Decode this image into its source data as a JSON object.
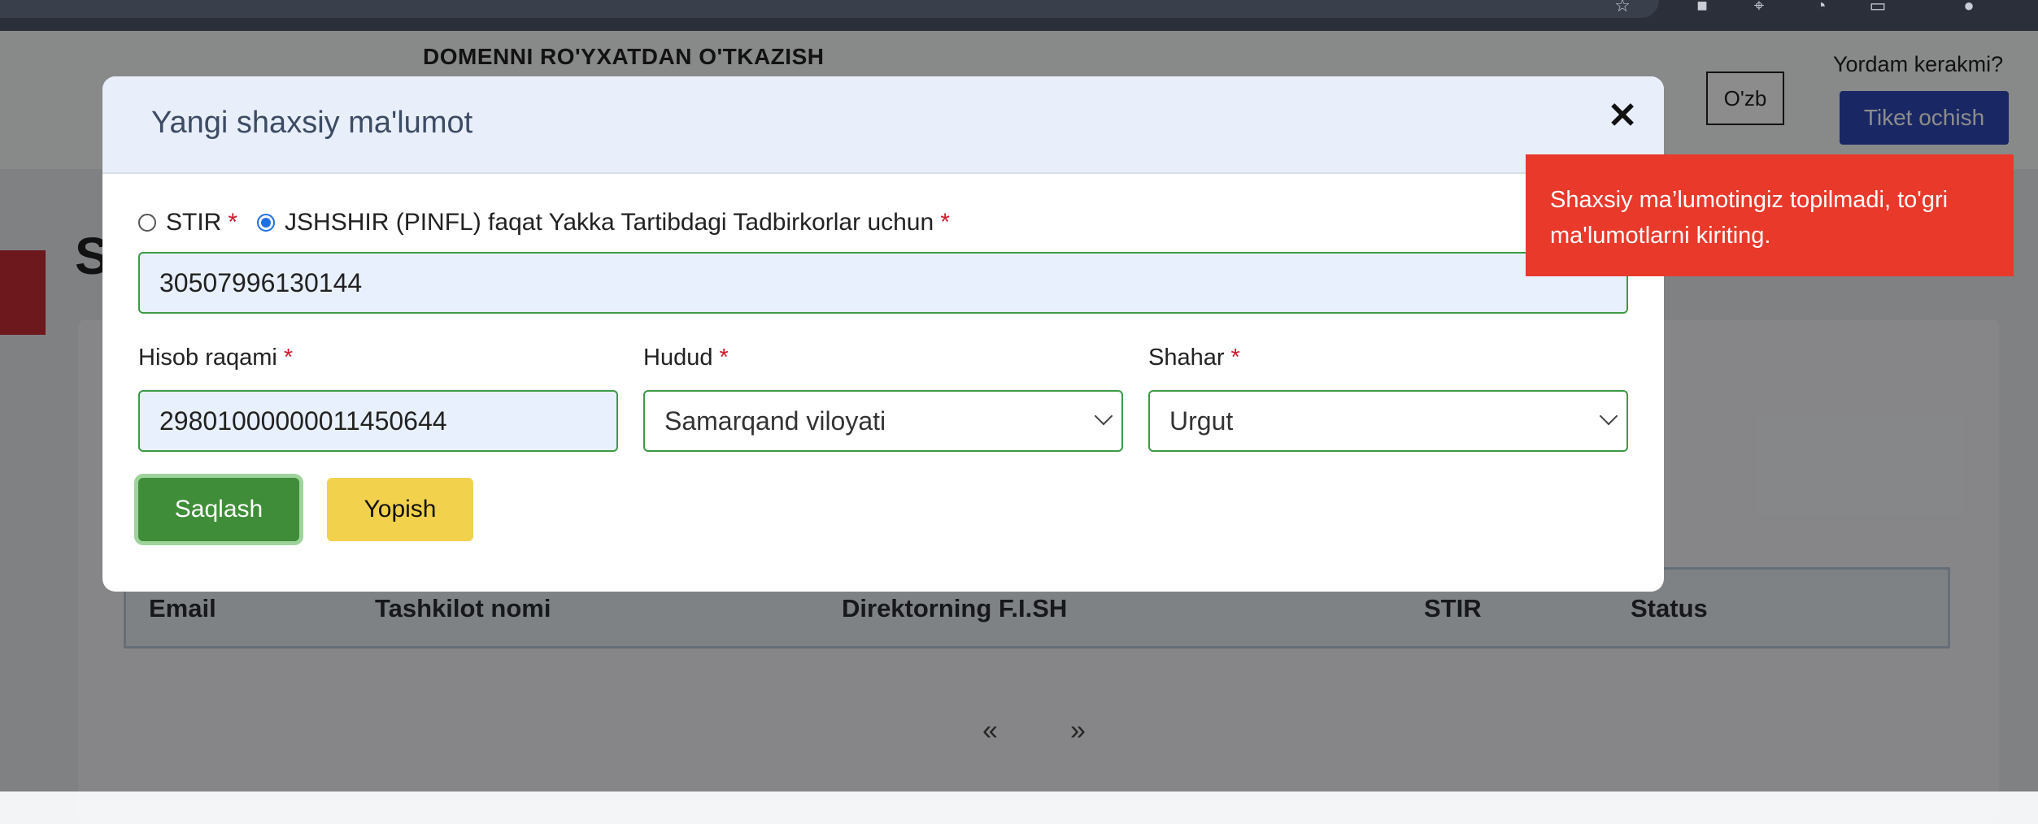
{
  "browser": {
    "icons": [
      "star-icon",
      "extension-icon",
      "pin-icon",
      "update-icon",
      "window-icon",
      "profile-icon"
    ]
  },
  "header": {
    "title": "DOMENNI RO'YXATDAN O'TKAZISH",
    "language": "O'zb",
    "help_text": "Yordam kerakmi?",
    "ticket_button": "Tiket ochish"
  },
  "background": {
    "page_heading_initial": "S",
    "table_headers": [
      "Email",
      "Tashkilot nomi",
      "Direktorning F.I.SH",
      "STIR",
      "Status"
    ],
    "pager_prev": "«",
    "pager_next": "»"
  },
  "modal": {
    "title": "Yangi shaxsiy ma'lumot",
    "close_symbol": "✕",
    "radio_stir": "STIR",
    "radio_pinfl": "JSHSHIR (PINFL) faqat Yakka Tartibdagi Tadbirkorlar uchun",
    "required_mark": "*",
    "pinfl_value": "30507996130144",
    "account_label": "Hisob raqami",
    "account_value": "29801000000011450644",
    "region_label": "Hudud",
    "region_value": "Samarqand viloyati",
    "city_label": "Shahar",
    "city_value": "Urgut",
    "save_button": "Saqlash",
    "close_button": "Yopish"
  },
  "toast": {
    "message": "Shaxsiy ma’lumotingiz topilmadi, to'gri ma'lumotlarni kiriting."
  },
  "colors": {
    "accent": "#2f4ab6",
    "success": "#3f8d38",
    "warning": "#f2d24d",
    "error": "#e8392b"
  }
}
